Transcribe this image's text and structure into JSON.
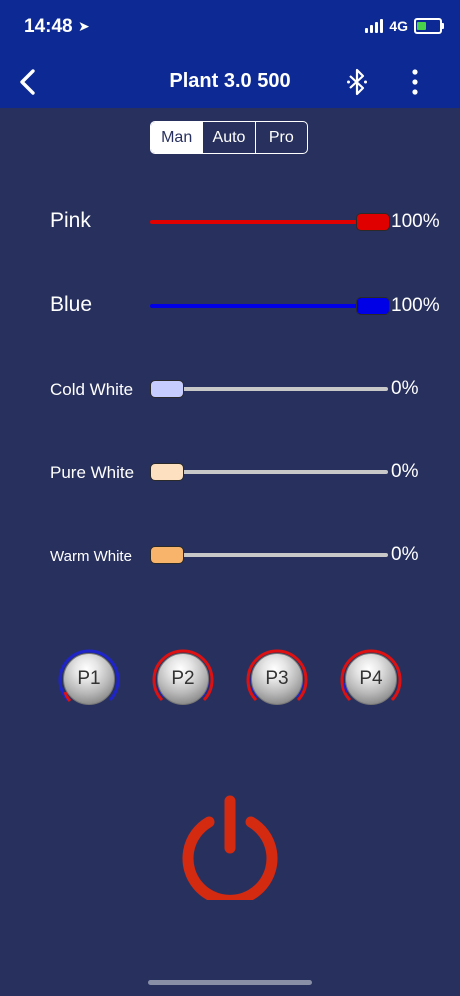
{
  "status_bar": {
    "time": "14:48",
    "network": "4G"
  },
  "header": {
    "title": "Plant 3.0 500"
  },
  "mode_tabs": [
    {
      "label": "Man",
      "selected": true
    },
    {
      "label": "Auto",
      "selected": false
    },
    {
      "label": "Pro",
      "selected": false
    }
  ],
  "channels": [
    {
      "label": "Pink",
      "value_text": "100%",
      "level": 1.0,
      "color": "#e00000"
    },
    {
      "label": "Blue",
      "value_text": "100%",
      "level": 1.0,
      "color": "#0000e6"
    },
    {
      "label": "Cold White",
      "value_text": "0%",
      "level": 0.0,
      "color": "#c7ccff"
    },
    {
      "label": "Pure White",
      "value_text": "0%",
      "level": 0.0,
      "color": "#fde0c0"
    },
    {
      "label": "Warm White",
      "value_text": "0%",
      "level": 0.0,
      "color": "#f9b46b"
    }
  ],
  "presets": [
    {
      "label": "P1"
    },
    {
      "label": "P2"
    },
    {
      "label": "P3"
    },
    {
      "label": "P4"
    }
  ],
  "colors": {
    "background": "#28315e",
    "header": "#0d2a94",
    "power": "#d42a10",
    "track_inactive": "#c8c8c8"
  }
}
